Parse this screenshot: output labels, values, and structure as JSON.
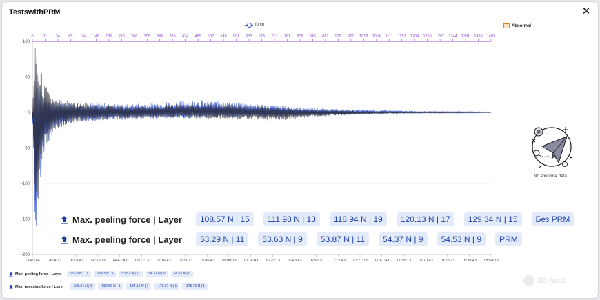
{
  "window": {
    "title": "TestswithPRM",
    "close_glyph": "✕"
  },
  "legend": {
    "force": "force",
    "abnormal": "Abnormal"
  },
  "abnormal_panel": {
    "no_data": "No abnormal data"
  },
  "summary_large": {
    "rows": [
      {
        "label": "Max. peeling force | Layer",
        "chips": [
          "108.57 N | 15",
          "111.98 N | 13",
          "118.94 N | 19",
          "120.13 N | 17",
          "129.34 N | 15",
          "Без PRM"
        ]
      },
      {
        "label": "Max. peeling force | Layer",
        "chips": [
          "53.29 N | 11",
          "53.63 N | 9",
          "53.87 N | 11",
          "54.37 N | 9",
          "54.53 N | 9",
          "PRM"
        ]
      }
    ]
  },
  "summary_small": {
    "rows": [
      {
        "label": "Max. peeling force | Layer",
        "chips": [
          "53.29 N | 11",
          "53.63 N | 9",
          "53.87 N | 11",
          "54.37 N | 9",
          "54.53 N | 9"
        ]
      },
      {
        "label": "Max. pressing force | Layer",
        "chips": [
          "-195.34 N | 1",
          "-189.69 N | 1",
          "-184.16 N | 1",
          "-179.67 N | 1",
          "-175.76 N | 1"
        ]
      }
    ]
  },
  "watermark": "3D Acct",
  "colors": {
    "series_blue": "#3b5bd6",
    "series_dark": "#2a2c3a",
    "top_axis": "#9b4fd6",
    "chip_bg": "#e3ebfb",
    "chip_text": "#1f3fa8"
  },
  "icons": {
    "close": "close-icon",
    "upload": "upload-arrow-icon",
    "no_data": "paper-plane-icon"
  },
  "chart_data": {
    "type": "line",
    "y_ticks": [
      "100",
      "50",
      "0",
      "-50",
      "-100",
      "-150",
      "-200"
    ],
    "ylim": [
      -200,
      100
    ],
    "x_ticks_bottom": [
      "13:49:44",
      "14:04:13",
      "14:18:43",
      "14:33:13",
      "14:47:43",
      "15:02:13",
      "15:16:43",
      "15:31:13",
      "15:45:43",
      "16:00:13",
      "16:14:43",
      "16:29:13",
      "16:43:43",
      "16:58:13",
      "17:12:43",
      "17:27:13",
      "17:41:43",
      "17:56:13",
      "18:10:43",
      "18:25:13",
      "18:39:43",
      "18:54:13"
    ],
    "x_ticks_top": [
      "0",
      "11",
      "34",
      "65",
      "104",
      "146",
      "186",
      "226",
      "266",
      "305",
      "345",
      "385",
      "424",
      "465",
      "507",
      "548",
      "591",
      "633",
      "675",
      "717",
      "761",
      "805",
      "846",
      "882",
      "925",
      "971",
      "1018",
      "1064",
      "1111",
      "1157",
      "1204",
      "1250",
      "1297",
      "1344",
      "1391",
      "1439",
      "1493"
    ],
    "xlim_layers": [
      0,
      1493
    ],
    "series": [
      {
        "name": "force",
        "color": "#3b5bd6",
        "envelope": {
          "layers": [
            0,
            8,
            11,
            20,
            34,
            65,
            104,
            146,
            226,
            305,
            385,
            465,
            548,
            633,
            717,
            805,
            882,
            971,
            1064,
            1157,
            1250,
            1344,
            1439,
            1493
          ],
          "max": [
            0,
            20,
            54,
            40,
            22,
            16,
            14,
            14,
            13,
            12,
            14,
            16,
            18,
            15,
            13,
            10,
            7,
            5,
            4,
            3,
            2,
            1.5,
            1,
            0.5
          ],
          "min": [
            0,
            -150,
            -195,
            -120,
            -60,
            -28,
            -18,
            -14,
            -12,
            -10,
            -9,
            -9,
            -8,
            -7,
            -6,
            -6,
            -5,
            -4,
            -3,
            -2,
            -1.5,
            -1,
            -1,
            -0.5
          ]
        }
      },
      {
        "name": "force",
        "color": "#2a2c3a",
        "envelope": {
          "layers": [
            0,
            8,
            11,
            20,
            34,
            65,
            104,
            146,
            226,
            305,
            385,
            465,
            548,
            633,
            717,
            805,
            882,
            971,
            1064,
            1157,
            1250,
            1344,
            1439,
            1493
          ],
          "max": [
            0,
            95,
            115,
            80,
            45,
            25,
            18,
            14,
            11,
            9,
            10,
            12,
            15,
            12,
            9,
            7,
            4,
            3,
            2,
            1.5,
            1,
            0.5,
            0.5,
            0.3
          ],
          "min": [
            0,
            -120,
            -175,
            -150,
            -70,
            -30,
            -18,
            -14,
            -11,
            -9,
            -8,
            -8,
            -9,
            -9,
            -10,
            -12,
            -8,
            -5,
            -3,
            -2,
            -1,
            -1,
            -0.5,
            -0.3
          ]
        }
      }
    ],
    "grid": true,
    "legend_position": "top"
  }
}
